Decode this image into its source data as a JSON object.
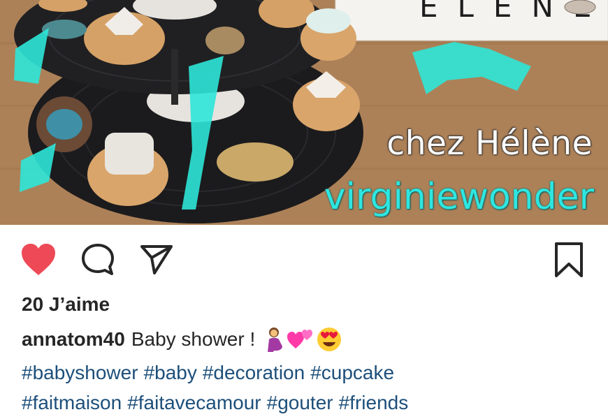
{
  "photo": {
    "overlay_line1": "chez Hélène",
    "overlay_line2": "virginiewonder",
    "lightbox_text": "ELENE"
  },
  "actions": {
    "like_icon": "heart-filled-icon",
    "comment_icon": "comment-bubble-icon",
    "share_icon": "paper-plane-icon",
    "save_icon": "bookmark-icon",
    "like_color": "#ed4956"
  },
  "post": {
    "likes": "20 J’aime",
    "username": "annatom40",
    "caption_text": "Baby shower !",
    "caption_emojis": [
      "pregnant-woman-emoji",
      "two-hearts-emoji",
      "heart-eyes-emoji"
    ],
    "hashtags_line1": [
      "#babyshower",
      "#baby",
      "#decoration",
      "#cupcake"
    ],
    "hashtags_line2": [
      "#faitmaison",
      "#faitavecamour",
      "#gouter",
      "#friends"
    ]
  },
  "colors": {
    "hashtag": "#1d4f7a",
    "text": "#262626",
    "overlay_cyan": "#2ee6e0"
  }
}
